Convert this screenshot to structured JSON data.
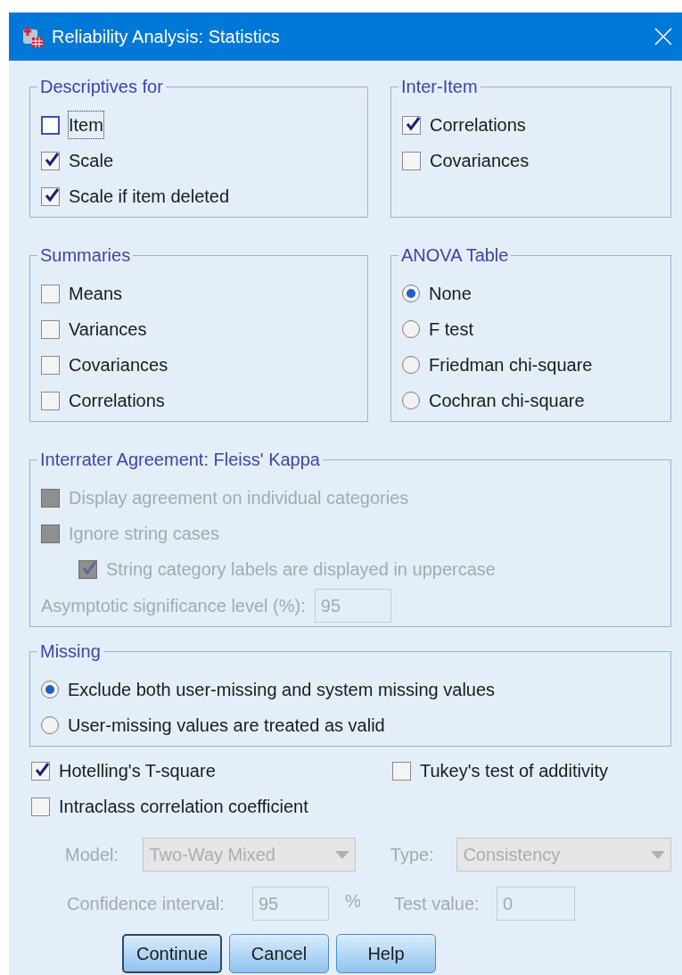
{
  "window": {
    "title": "Reliability Analysis: Statistics"
  },
  "rows": [
    [
      {
        "title": "Descriptives for",
        "disabled": false,
        "items": [
          {
            "kind": "checkbox",
            "label": "Item",
            "checked": false,
            "focused": true
          },
          {
            "kind": "checkbox",
            "label": "Scale",
            "checked": true
          },
          {
            "kind": "checkbox",
            "label": "Scale if item deleted",
            "checked": true
          }
        ]
      },
      {
        "title": "Inter-Item",
        "disabled": false,
        "items": [
          {
            "kind": "checkbox",
            "label": "Correlations",
            "checked": true
          },
          {
            "kind": "checkbox",
            "label": "Covariances",
            "checked": false
          }
        ]
      }
    ],
    [
      {
        "title": "Summaries",
        "disabled": false,
        "items": [
          {
            "kind": "checkbox",
            "label": "Means",
            "checked": false
          },
          {
            "kind": "checkbox",
            "label": "Variances",
            "checked": false
          },
          {
            "kind": "checkbox",
            "label": "Covariances",
            "checked": false
          },
          {
            "kind": "checkbox",
            "label": "Correlations",
            "checked": false
          }
        ]
      },
      {
        "title": "ANOVA Table",
        "disabled": false,
        "items": [
          {
            "kind": "radio",
            "label": "None",
            "selected": true
          },
          {
            "kind": "radio",
            "label": "F test",
            "selected": false
          },
          {
            "kind": "radio",
            "label": "Friedman chi-square",
            "selected": false
          },
          {
            "kind": "radio",
            "label": "Cochran chi-square",
            "selected": false
          }
        ]
      }
    ],
    [
      {
        "title": "Interrater Agreement: Fleiss' Kappa",
        "disabled": true,
        "items": [
          {
            "kind": "checkbox",
            "label": "Display agreement on individual categories",
            "checked": false
          },
          {
            "kind": "checkbox",
            "label": "Ignore string cases",
            "checked": false,
            "children": [
              {
                "kind": "checkbox",
                "label": "String category labels are displayed in uppercase",
                "checked": true
              }
            ]
          },
          {
            "kind": "field",
            "label": "Asymptotic significance level (%):",
            "value": "95"
          }
        ]
      }
    ],
    [
      {
        "title": "Missing",
        "disabled": false,
        "items": [
          {
            "kind": "radio",
            "label": "Exclude both user-missing and system missing values",
            "selected": true
          },
          {
            "kind": "radio",
            "label": "User-missing values are treated as valid",
            "selected": false
          }
        ]
      }
    ]
  ],
  "options": [
    {
      "label": "Hotelling's T-square",
      "checked": true
    },
    {
      "label": "Tukey's test of additivity",
      "checked": false
    },
    {
      "label": "Intraclass correlation coefficient",
      "checked": false
    }
  ],
  "icc": {
    "disabled": true,
    "model": {
      "label": "Model:",
      "value": "Two-Way Mixed"
    },
    "type": {
      "label": "Type:",
      "value": "Consistency"
    },
    "confidence_interval": {
      "label": "Confidence interval:",
      "value": "95",
      "unit": "%"
    },
    "test_value": {
      "label": "Test value:",
      "value": "0"
    }
  },
  "buttons": [
    {
      "label": "Continue",
      "default": true
    },
    {
      "label": "Cancel",
      "default": false
    },
    {
      "label": "Help",
      "default": false
    }
  ]
}
